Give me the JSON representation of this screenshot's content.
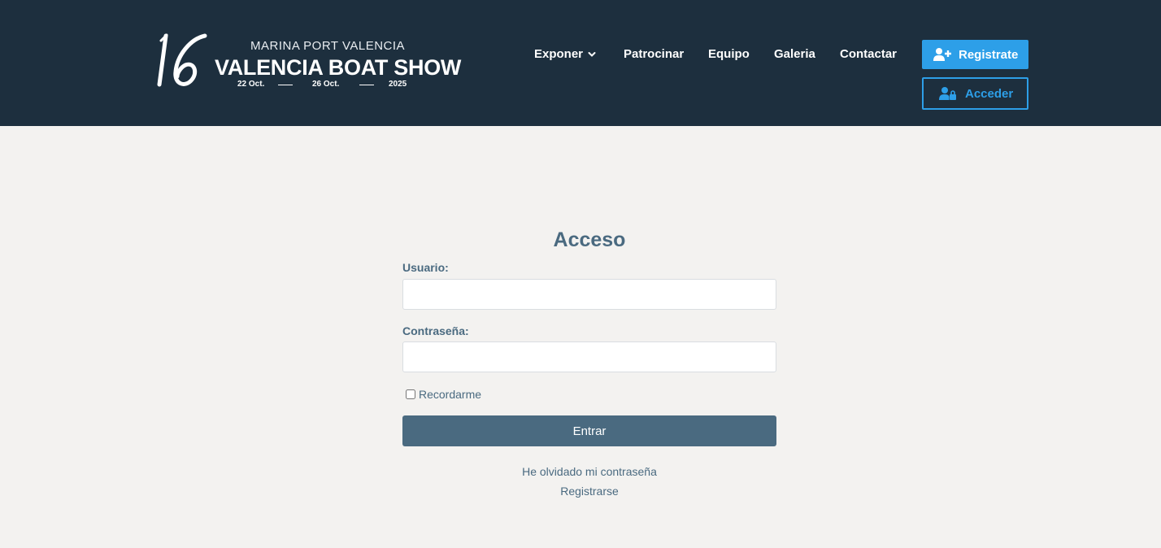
{
  "logo": {
    "number": "16",
    "subtitle": "MARINA PORT VALENCIA",
    "title": "VALENCIA BOAT SHOW",
    "date_start": "22 Oct.",
    "date_end": "26 Oct.",
    "year": "2025"
  },
  "nav": {
    "items": [
      {
        "label": "Exponer",
        "has_dropdown": true
      },
      {
        "label": "Patrocinar"
      },
      {
        "label": "Equipo"
      },
      {
        "label": "Galeria"
      },
      {
        "label": "Contactar"
      }
    ],
    "register_label": "Registrate",
    "login_label": "Acceder"
  },
  "form": {
    "title": "Acceso",
    "username_label": "Usuario:",
    "username_value": "",
    "password_label": "Contraseña:",
    "password_value": "",
    "remember_label": "Recordarme",
    "remember_checked": false,
    "submit_label": "Entrar",
    "forgot_link": "He olvidado mi contraseña",
    "register_link": "Registrarse"
  },
  "colors": {
    "header_bg": "#1d2f3e",
    "page_bg": "#f3f2f0",
    "accent": "#2d9fe8",
    "form_text": "#4a6a80",
    "submit_bg": "#4a6a80"
  },
  "icons": {
    "register": "user-plus-icon",
    "login": "user-lock-icon",
    "dropdown": "chevron-down-icon"
  }
}
